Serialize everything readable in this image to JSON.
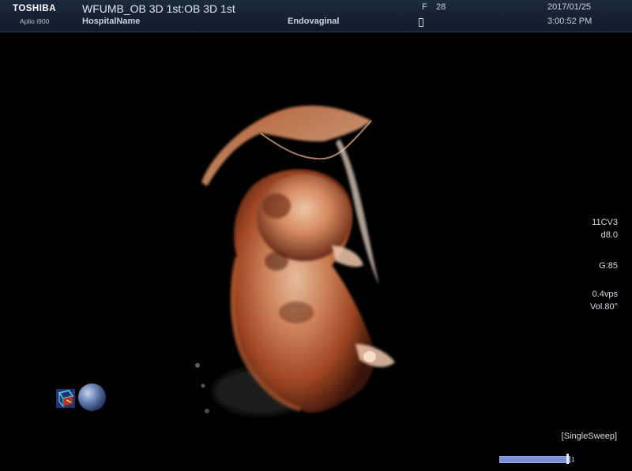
{
  "header": {
    "brand": "TOSHIBA",
    "model": "Aplio i900",
    "title": "WFUMB_OB 3D 1st:OB 3D 1st",
    "hospital": "HospitalName",
    "probe_mode": "Endovaginal",
    "frame_label": "F",
    "frame_number": "28",
    "date": "2017/01/25",
    "time": "3:00:52 PM"
  },
  "params": {
    "transducer": "11CV3",
    "depth": "d8.0",
    "gain": "G:85",
    "volume_rate": "0.4vps",
    "volume_angle": "Vol.80°"
  },
  "mode": {
    "sweep": "[SingleSweep]",
    "cine_index": "1"
  },
  "colors": {
    "render_tone": "#c8643a",
    "cine_bar": "#7d8ed9",
    "header_bg": "#16233a"
  },
  "icons": {
    "orientation_cube": "orientation-cube-icon",
    "orientation_sphere": "orientation-sphere-icon"
  }
}
